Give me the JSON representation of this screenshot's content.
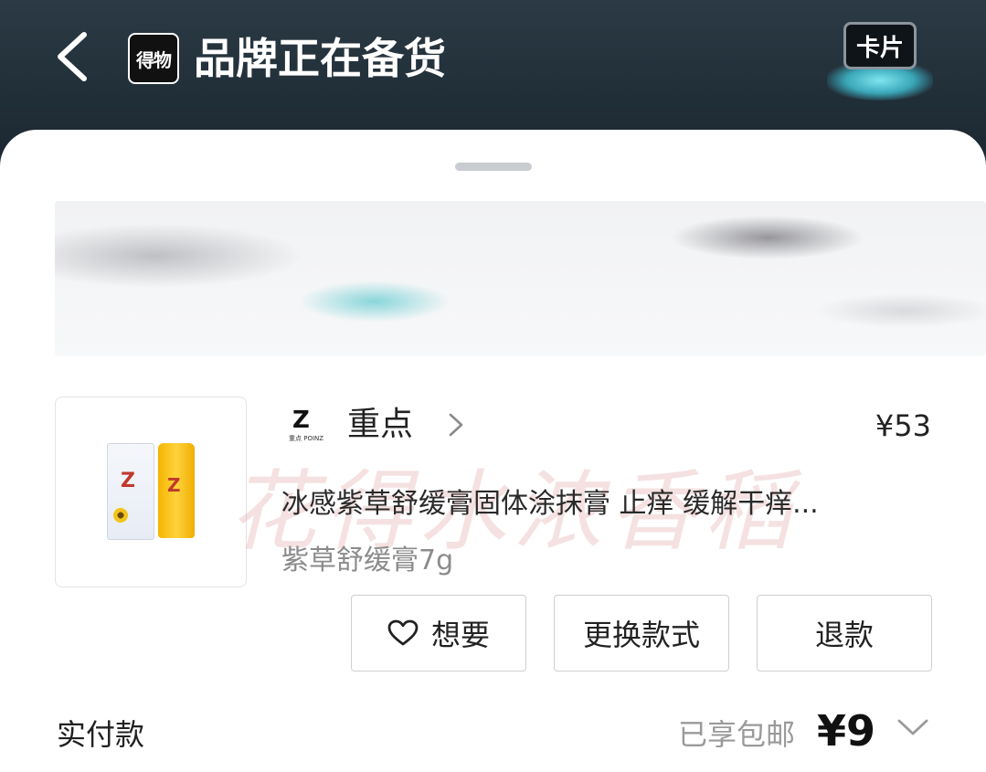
{
  "header": {
    "logo_text": "得物",
    "title": "品牌正在备货",
    "card_badge": "卡片"
  },
  "order": {
    "brand": {
      "logo_mark": "Z",
      "logo_subtext": "重点 POINZ",
      "name": "重点"
    },
    "price": "¥53",
    "product_title": "冰感紫草舒缓膏固体涂抹膏 止痒 缓解干痒...",
    "product_spec": "紫草舒缓膏7g",
    "watermark": "花得水浓香稻"
  },
  "actions": {
    "want": "想要",
    "change_style": "更换款式",
    "refund": "退款"
  },
  "payment": {
    "label": "实付款",
    "free_shipping": "已享包邮",
    "total": "¥9"
  },
  "colors": {
    "header_bg": "#22303a",
    "badge_glow": "#7fe6f0",
    "text_primary": "#222222",
    "text_secondary": "#8b8b8b"
  }
}
